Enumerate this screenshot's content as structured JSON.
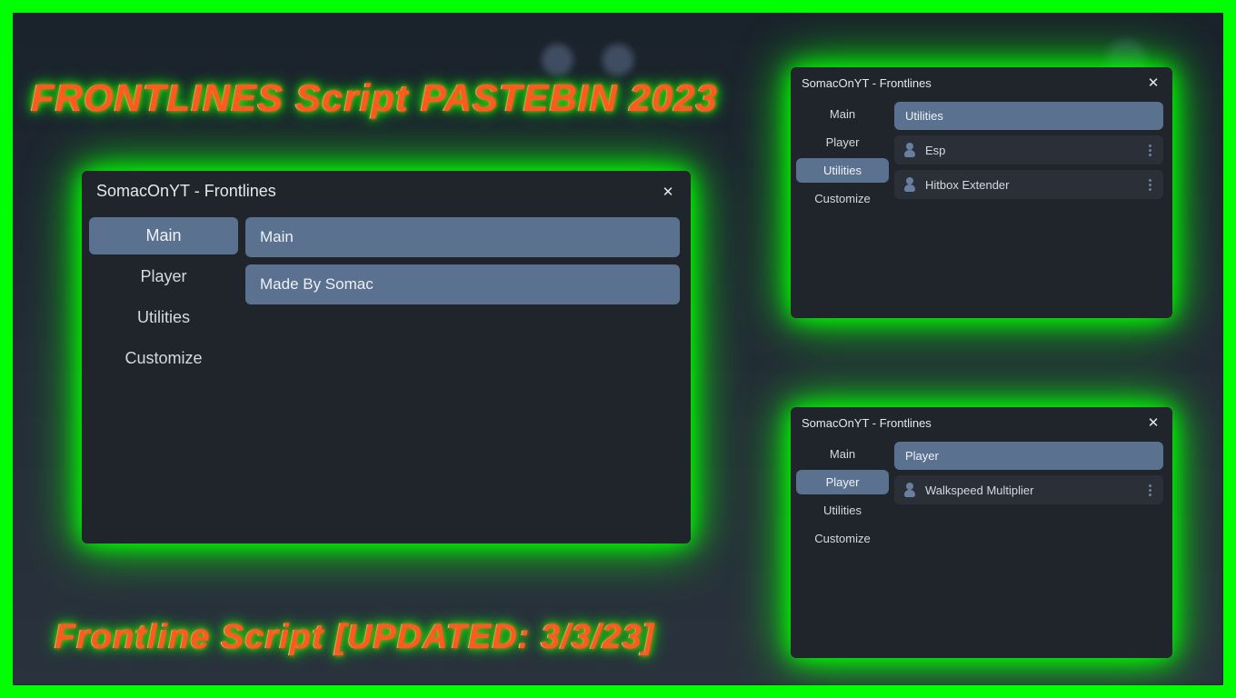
{
  "title_top": "FRONTLINES Script PASTEBIN 2023",
  "title_bottom": "Frontline Script [UPDATED: 3/3/23]",
  "panel_main": {
    "title": "SomacOnYT - Frontlines",
    "tabs": {
      "main": "Main",
      "player": "Player",
      "utilities": "Utilities",
      "customize": "Customize"
    },
    "section_header": "Main",
    "credit": "Made By Somac"
  },
  "panel_util": {
    "title": "SomacOnYT - Frontlines",
    "tabs": {
      "main": "Main",
      "player": "Player",
      "utilities": "Utilities",
      "customize": "Customize"
    },
    "section_header": "Utilities",
    "items": {
      "0": "Esp",
      "1": "Hitbox Extender"
    }
  },
  "panel_player": {
    "title": "SomacOnYT - Frontlines",
    "tabs": {
      "main": "Main",
      "player": "Player",
      "utilities": "Utilities",
      "customize": "Customize"
    },
    "section_header": "Player",
    "items": {
      "0": "Walkspeed Multiplier"
    }
  }
}
